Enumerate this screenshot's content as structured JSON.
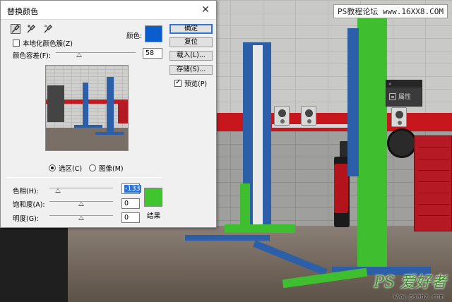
{
  "dialog": {
    "title": "替换颜色",
    "eyedroppers": [
      {
        "icon": "eyedropper-icon",
        "active": true
      },
      {
        "icon": "eyedropper-plus-icon",
        "active": false
      },
      {
        "icon": "eyedropper-minus-icon",
        "active": false
      }
    ],
    "localized_clusters": {
      "label": "本地化颜色簇(Z)",
      "checked": false
    },
    "color_label": "颜色:",
    "selection_color": "#0a5dcc",
    "fuzziness": {
      "label": "颜色容差(F):",
      "value": "58",
      "slider_fraction": 0.29
    },
    "mode": {
      "selection": {
        "label": "选区(C)",
        "selected": true
      },
      "image": {
        "label": "图像(M)",
        "selected": false
      }
    },
    "buttons": {
      "ok": "确定",
      "reset": "复位",
      "load": "载入(L)...",
      "save": "存储(S)..."
    },
    "preview": {
      "label": "预览(P)",
      "checked": true
    },
    "hue": {
      "label": "色相(H):",
      "value": "-133",
      "slider_fraction": 0.13
    },
    "saturation": {
      "label": "饱和度(A):",
      "value": "0",
      "slider_fraction": 0.5
    },
    "lightness": {
      "label": "明度(G):",
      "value": "0",
      "slider_fraction": 0.5
    },
    "result": {
      "label": "结果",
      "color": "#40c52e"
    }
  },
  "properties_panel": {
    "label": "属性",
    "icon": "properties-icon"
  },
  "watermark": {
    "top": "PS教程论坛 www.16XX8.COM",
    "bottom": "PS 爱好者",
    "bottom_url": "www.psahz.com"
  }
}
